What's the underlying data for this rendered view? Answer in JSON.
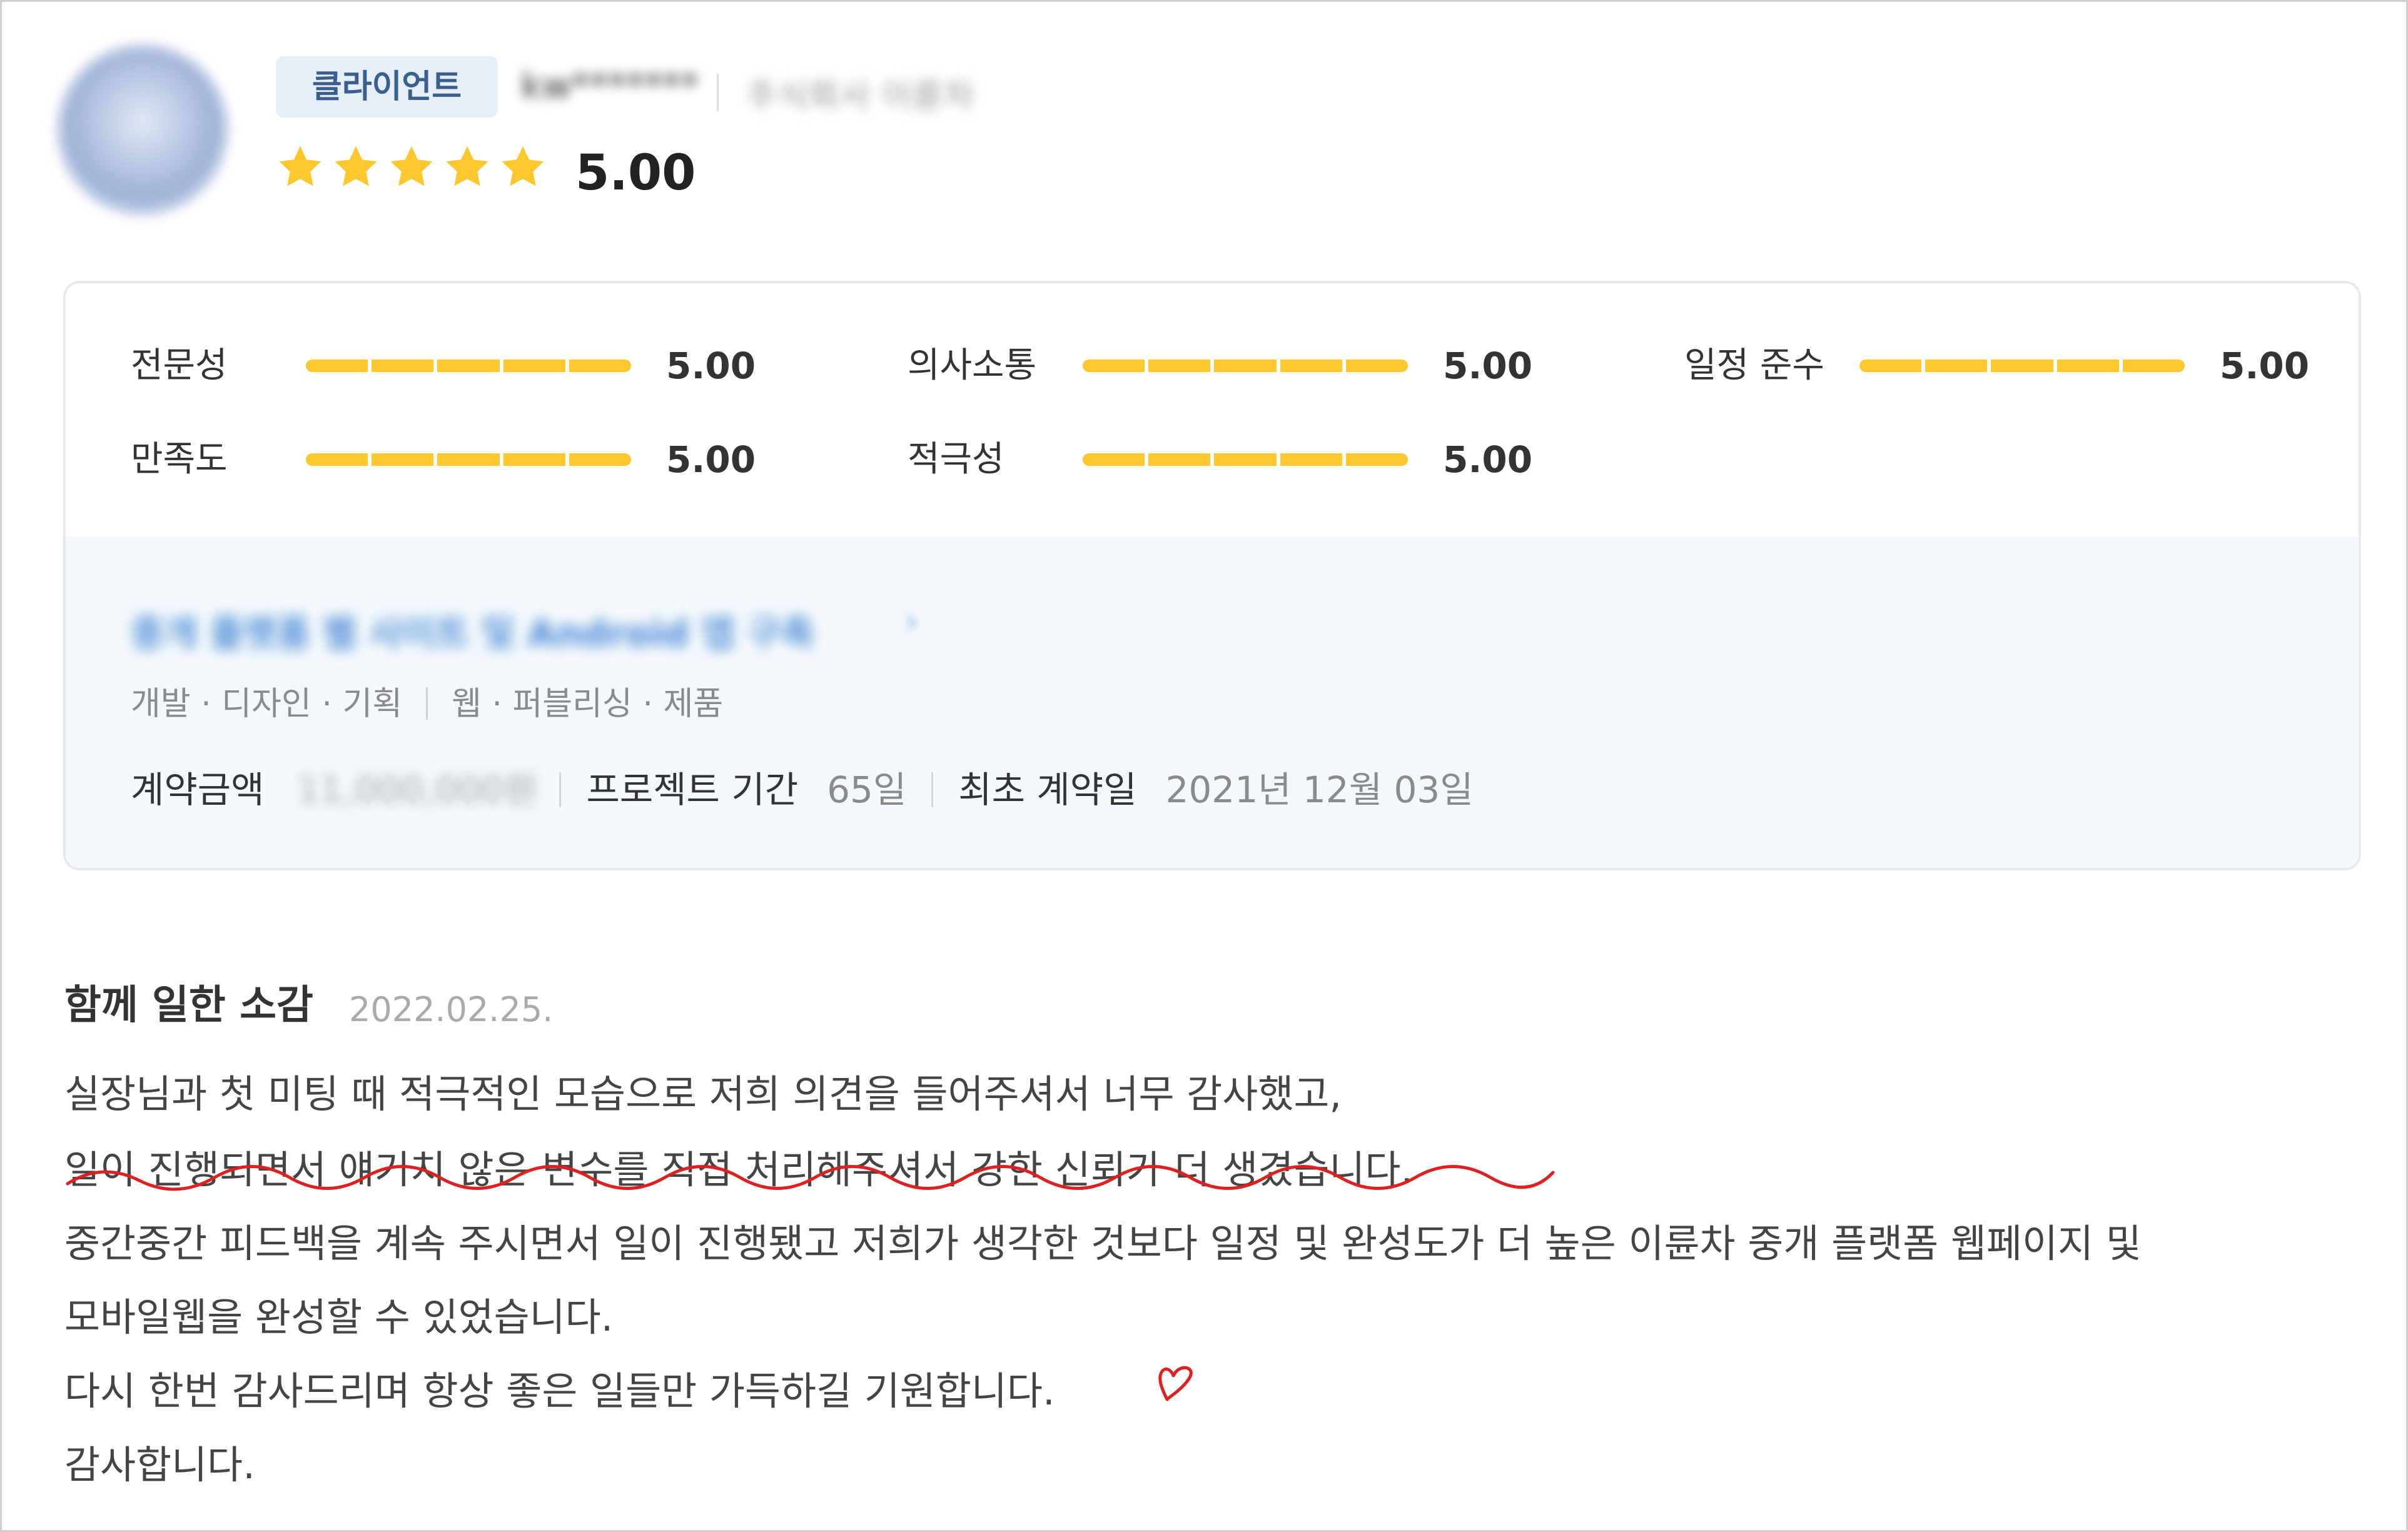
{
  "header": {
    "badge": "클라이언트",
    "client_name": "kw*******",
    "client_company": "주식회사 이륜차",
    "stars": [
      1,
      1,
      1,
      1,
      1
    ],
    "overall_score": "5.00"
  },
  "ratings": [
    {
      "label": "전문성",
      "value": "5.00",
      "fill": 1.0
    },
    {
      "label": "의사소통",
      "value": "5.00",
      "fill": 1.0
    },
    {
      "label": "일정 준수",
      "value": "5.00",
      "fill": 1.0
    },
    {
      "label": "만족도",
      "value": "5.00",
      "fill": 1.0
    },
    {
      "label": "적극성",
      "value": "5.00",
      "fill": 1.0
    }
  ],
  "project": {
    "title": "중개 플랫폼 웹 사이트 및 Android 앱 구축",
    "chevron": "›",
    "tags_left": "개발 · 디자인 · 기획",
    "tags_right": "웹 · 퍼블리싱 · 제품",
    "contract_amount_label": "계약금액",
    "contract_amount_value": "11,000,000원",
    "period_label": "프로젝트 기간",
    "period_value": "65일",
    "first_contract_label": "최초 계약일",
    "first_contract_value": "2021년 12월 03일"
  },
  "feedback": {
    "title": "함께 일한 소감",
    "date": "2022.02.25.",
    "lines": [
      "실장님과 첫 미팅 때 적극적인 모습으로 저희 의견을 들어주셔서 너무 감사했고,",
      "일이 진행되면서 얘기치 않은 변수를 직접 처리해주셔서 강한 신뢰가 더 생겼습니다.",
      "중간중간 피드백을 계속 주시면서 일이 진행됐고 저희가 생각한 것보다 일정 및 완성도가 더 높은 이륜차 중개 플랫폼 웹페이지 및",
      "모바일웹을 완성할 수 있었습니다.",
      "다시 한번 감사드리며 항상 좋은 일들만 가득하길 기원합니다.",
      "감사합니다."
    ]
  },
  "colors": {
    "star": "#fdc72e",
    "bar": "#fdc72e",
    "annotation": "#e02020",
    "badge_bg": "#e6eef7",
    "panel_bg": "#f3f8fc"
  },
  "icons": {
    "star": "star-icon",
    "annotation_heart": "heart-doodle-icon",
    "annotation_underline": "wavy-underline-annotation"
  }
}
